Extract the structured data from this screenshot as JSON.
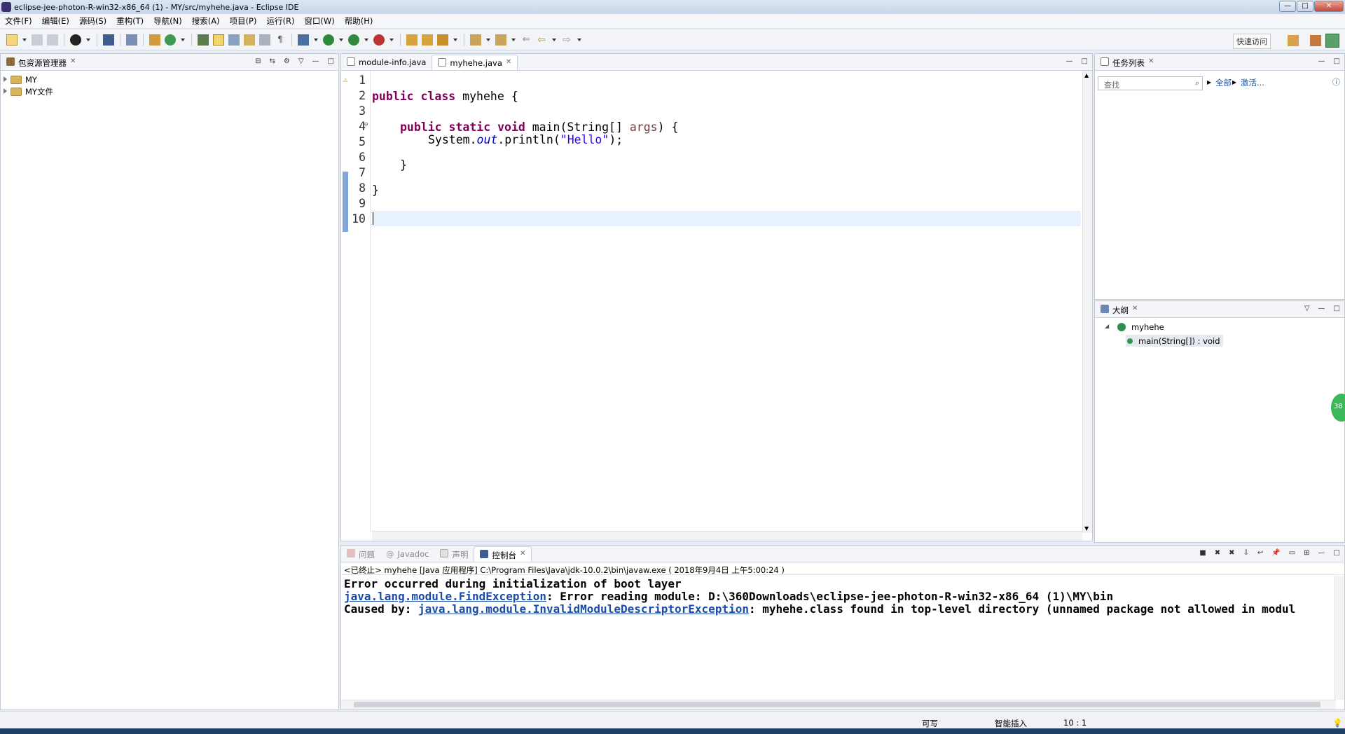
{
  "window": {
    "title": "eclipse-jee-photon-R-win32-x86_64 (1) - MY/src/myhehe.java - Eclipse IDE",
    "controls": [
      "—",
      "□",
      "✕"
    ]
  },
  "menu": [
    "文件(F)",
    "编辑(E)",
    "源码(S)",
    "重构(T)",
    "导航(N)",
    "搜索(A)",
    "项目(P)",
    "运行(R)",
    "窗口(W)",
    "帮助(H)"
  ],
  "toolbar": {
    "quick_access": "快速访问"
  },
  "explorer": {
    "title": "包资源管理器",
    "items": [
      "MY",
      "MY文件"
    ]
  },
  "editor": {
    "tabs": [
      {
        "label": "module-info.java"
      },
      {
        "label": "myhehe.java"
      }
    ],
    "line_numbers": [
      "1",
      "2",
      "3",
      "4",
      "5",
      "6",
      "7",
      "8",
      "9",
      "10"
    ],
    "lines": {
      "l2_kw": "public class",
      "l2_rest": " myhehe {",
      "l4_kw": "public static void",
      "l4_rest": " main(String[] ",
      "l4_param": "args",
      "l4_end": ") {",
      "l5_a": "System.",
      "l5_out": "out",
      "l5_b": ".println(",
      "l5_str": "\"Hello\"",
      "l5_c": ");",
      "l7": "}",
      "l9": "}"
    }
  },
  "tasks": {
    "title": "任务列表",
    "search_placeholder": "查找",
    "all_label": "全部",
    "activate_label": "激活..."
  },
  "outline": {
    "title": "大纲",
    "class_name": "myhehe",
    "method": "main(String[]) : void"
  },
  "bottom": {
    "tabs": [
      "问题",
      "Javadoc",
      "声明",
      "控制台"
    ],
    "launch_info": "<已终止> myhehe [Java 应用程序] C:\\Program Files\\Java\\jdk-10.0.2\\bin\\javaw.exe ( 2018年9月4日 上午5:00:24 )",
    "line1": "Error occurred during initialization of boot layer",
    "line2_link": "java.lang.module.FindException",
    "line2_rest": ": Error reading module: D:\\360Downloads\\eclipse-jee-photon-R-win32-x86_64 (1)\\MY\\bin",
    "line3_prefix": "Caused by: ",
    "line3_link": "java.lang.module.InvalidModuleDescriptorException",
    "line3_rest": ": myhehe.class found in top-level directory (unnamed package not allowed in modul"
  },
  "status": {
    "writable": "可写",
    "insert_mode": "智能插入",
    "position": "10 : 1"
  },
  "badge": "38"
}
